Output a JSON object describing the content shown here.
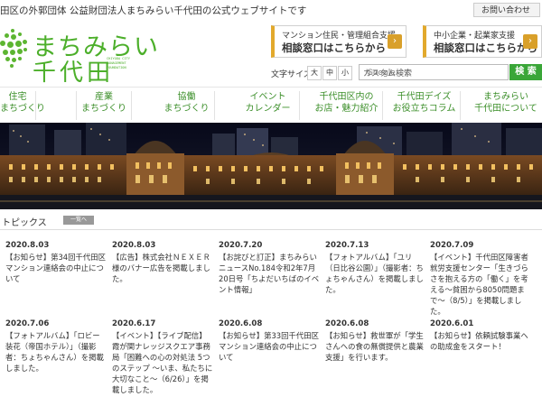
{
  "header": {
    "description": "田区の外郭団体 公益財団法人まちみらい千代田の公式ウェブサイトです",
    "inquiry_label": "お問い合わせ"
  },
  "logo": {
    "line1": "まちみらい",
    "line2": "千代田",
    "line3": "CHIYODA CITY MANAGEMENT FOUNDATION"
  },
  "banners": [
    {
      "line1": "マンション住民・管理組合支援",
      "line2": "相談窓口はこちらから"
    },
    {
      "line1": "中小企業・起業家支援",
      "line2": "相談窓口はこちらから"
    }
  ],
  "font_size": {
    "label": "文字サイズ",
    "options": [
      "大",
      "中",
      "小"
    ]
  },
  "search": {
    "google": "Google",
    "placeholder": "カスタム検索",
    "button": "検 索"
  },
  "nav": [
    {
      "line1": "住宅",
      "line2": "まちづくり"
    },
    {
      "line1": "産業",
      "line2": "まちづくり"
    },
    {
      "line1": "協働",
      "line2": "まちづくり"
    },
    {
      "line1": "イベント",
      "line2": "カレンダー"
    },
    {
      "line1": "千代田区内の",
      "line2": "お店・魅力紹介"
    },
    {
      "line1": "千代田デイズ",
      "line2": "お役立ちコラム"
    },
    {
      "line1": "まちみらい",
      "line2": "千代田について"
    }
  ],
  "topics": {
    "title": "トピックス",
    "list_label": "一覧へ",
    "items": [
      {
        "date": "2020.8.03",
        "text": "【お知らせ】第34回千代田区マンション連絡会の中止について"
      },
      {
        "date": "2020.8.03",
        "text": "【広告】株式会社ＮＥＸＥＲ様のバナー広告を掲載しました。"
      },
      {
        "date": "2020.7.20",
        "text": "【お詫びと訂正】まちみらいニュースNo.184令和2年7月20日号「ちよだいちばのイベント情報」"
      },
      {
        "date": "2020.7.13",
        "text": "【フォトアルバム】「ユリ（日比谷公園）」（撮影者：ちょちゃんさん）を掲載しました。"
      },
      {
        "date": "2020.7.09",
        "text": "【イベント】千代田区障害者就労支援センター「生きづらさを抱える方の「働く」を考える〜貧困から8050問題まで〜（8/5）」を掲載しました。"
      },
      {
        "date": "2020.7.06",
        "text": "【フォトアルバム】「ロビー装花（帝国ホテル）」（撮影者：ちょちゃんさん）を掲載しました。"
      },
      {
        "date": "2020.6.17",
        "text": "【イベント】【ライブ配信】霞が関ナレッジスクエア事務局「困難への心の対処法 5つのステップ 〜いま、私たちに大切なこと〜（6/26）」を掲載しました。"
      },
      {
        "date": "2020.6.08",
        "text": "【お知らせ】第33回千代田区マンション連絡会の中止について"
      },
      {
        "date": "2020.6.08",
        "text": "【お知らせ】救世軍が「学生さんへの食の無償提供と農業支援」を行います。"
      },
      {
        "date": "2020.6.01",
        "text": "【お知らせ】依頼試験事業への助成金をスタート！"
      }
    ]
  },
  "colors": {
    "brand_green": "#4caf2a",
    "search_green": "#3aa638",
    "banner_accent": "#e2a92c"
  }
}
